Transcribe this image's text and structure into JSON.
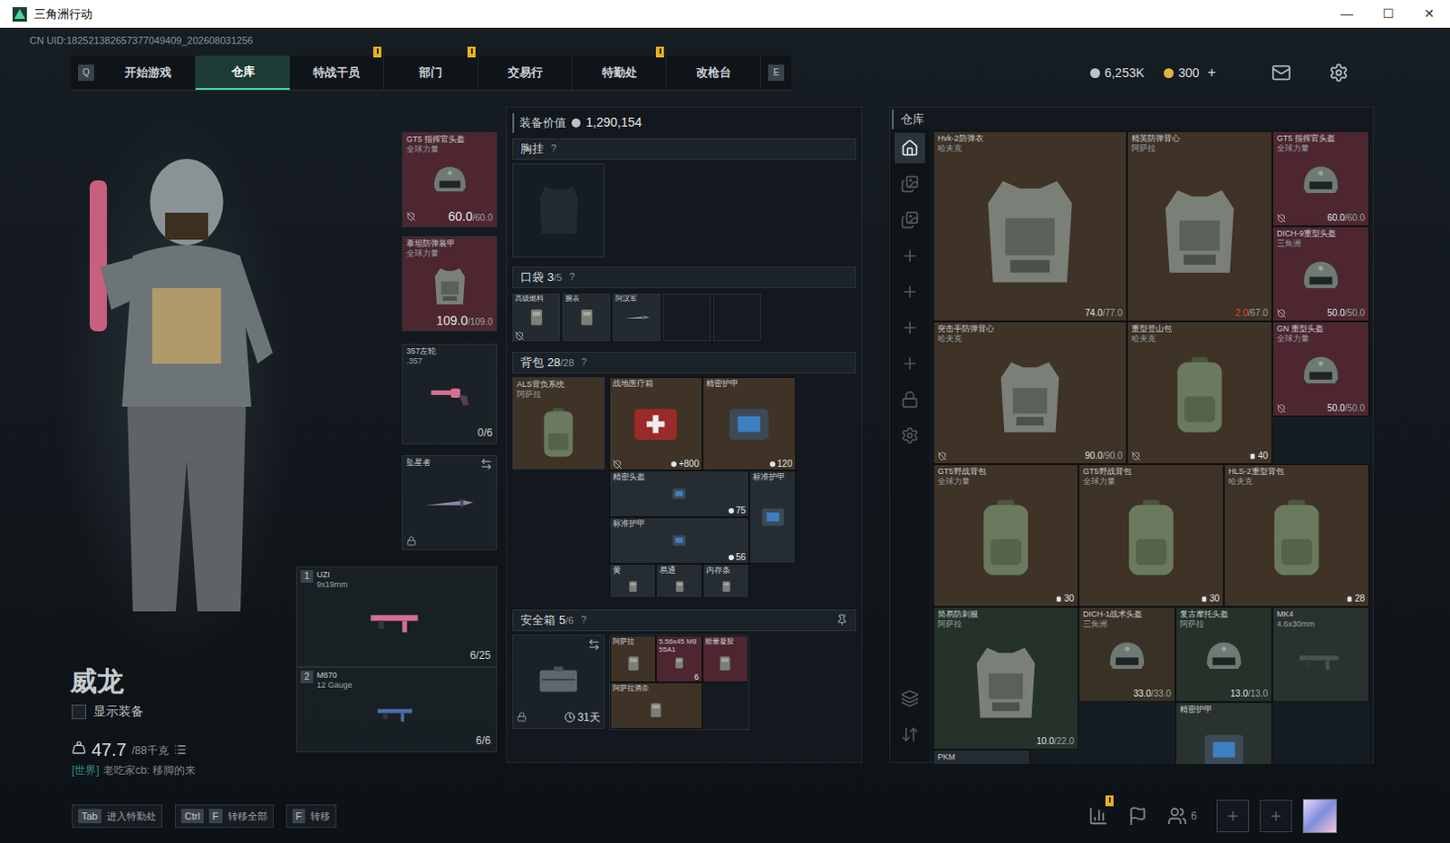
{
  "window": {
    "title": "三角洲行动",
    "controls": [
      "—",
      "☐",
      "✕"
    ]
  },
  "uid": "CN UID:182521382657377049409_202608031256",
  "nav": {
    "prev_key": "Q",
    "next_key": "E",
    "tabs": [
      {
        "label": "开始游戏",
        "selected": false,
        "alert": false
      },
      {
        "label": "仓库",
        "selected": true,
        "alert": false
      },
      {
        "label": "特战干员",
        "selected": false,
        "alert": true
      },
      {
        "label": "部门",
        "selected": false,
        "alert": true
      },
      {
        "label": "交易行",
        "selected": false,
        "alert": false
      },
      {
        "label": "特勤处",
        "selected": false,
        "alert": true
      },
      {
        "label": "改枪台",
        "selected": false,
        "alert": false
      }
    ]
  },
  "currency": [
    {
      "value": "6,253K",
      "add": "",
      "color": "#b8c2ca"
    },
    {
      "value": "300",
      "add": "+",
      "color": "#e3b341"
    }
  ],
  "operator": {
    "name": "威龙",
    "show_gear_label": "显示装备",
    "show_gear_checked": false,
    "weight": "47.7",
    "weight_max": "/88千克",
    "chat_channel": "[世界]",
    "chat_text": "老吃家cb: 移脚的来"
  },
  "equipment": [
    {
      "label": "GT5 指挥官头盔",
      "sub": "全球力量",
      "kind": "helmet",
      "value": "60.0",
      "max": "/60.0",
      "marked": true,
      "color": "#4d2630"
    },
    {
      "label": "泰坦防弹装甲",
      "sub": "全球力量",
      "kind": "armor",
      "value": "109.0",
      "max": "/109.0",
      "marked": false,
      "color": "#4d2630"
    },
    {
      "label": "357左轮",
      "sub": ".357",
      "kind": "pistol",
      "ammo": "0/6",
      "marked": false,
      "color": "#1b2227"
    },
    {
      "label": "坠星者",
      "sub": "",
      "kind": "knife",
      "locked": true,
      "marked": false,
      "color": "#1b2227"
    }
  ],
  "weapons": [
    {
      "slot": "1",
      "name": "UZI",
      "caliber": "9x19mm",
      "ammo": "6/25",
      "color": "#d46f91"
    },
    {
      "slot": "2",
      "name": "M870",
      "caliber": "12 Gauge",
      "ammo": "6/6",
      "color": "#4b6da8"
    }
  ],
  "loadout": {
    "value_label": "装备价值",
    "value": "1,290,154",
    "chest": {
      "label": "胸挂",
      "help": "?"
    },
    "pockets": {
      "label": "口袋",
      "count": "3",
      "max": "/5",
      "help": "?",
      "slots": [
        {
          "label": "高级燃料",
          "kind": "small",
          "empty": false,
          "marked": true
        },
        {
          "label": "腕表",
          "kind": "small",
          "empty": false,
          "marked": false
        },
        {
          "label": "阿汉军",
          "kind": "knife",
          "empty": false,
          "marked": false
        },
        {
          "label": "",
          "kind": "small",
          "empty": true,
          "marked": false
        },
        {
          "label": "",
          "kind": "small",
          "empty": true,
          "marked": false
        }
      ]
    },
    "backpack": {
      "label": "背包",
      "count": "28",
      "max": "/28",
      "help": "?",
      "bag": {
        "label": "ALS背负系统",
        "sub": "阿萨拉",
        "color": "#3f3226"
      },
      "items": [
        {
          "label": "战地医疗箱",
          "kind": "medkit",
          "stat": "+800",
          "marked": true,
          "color": "#3f3226"
        },
        {
          "label": "精密护甲",
          "kind": "plate",
          "stat": "120",
          "marked": false,
          "color": "#3f3226"
        },
        {
          "label": "精密头盔",
          "kind": "plate",
          "stat": "75",
          "marked": false,
          "color": "#252d33"
        },
        {
          "label": "标准护甲",
          "kind": "plate",
          "stat": "",
          "marked": false,
          "color": "#252d33"
        },
        {
          "label": "标准护甲",
          "kind": "plate",
          "stat": "56",
          "marked": false,
          "color": "#252d33"
        },
        {
          "label": "黄",
          "kind": "small",
          "stat": "",
          "marked": false,
          "color": "#252d33"
        },
        {
          "label": "易通",
          "kind": "small",
          "stat": "",
          "marked": false,
          "color": "#252d33"
        },
        {
          "label": "内存条",
          "kind": "small",
          "stat": "",
          "marked": false,
          "color": "#252d33"
        }
      ]
    },
    "safe": {
      "label": "安全箱",
      "count": "5",
      "max": "/6",
      "help": "?",
      "expiry": "31天",
      "locked": true,
      "items": [
        {
          "label": "阿萨拉",
          "kind": "small",
          "count": "",
          "color": "#3f3226"
        },
        {
          "label": "5.56x45 M855A1",
          "kind": "small",
          "count": "6",
          "color": "#4d2630"
        },
        {
          "label": "能量凝胶",
          "kind": "small",
          "count": "",
          "color": "#4d2630"
        },
        {
          "label": "阿萨拉酒壶",
          "kind": "small",
          "count": "",
          "color": "#3f3226"
        }
      ]
    }
  },
  "stash": {
    "title": "仓库",
    "sidebar": [
      {
        "kind": "home",
        "selected": true
      },
      {
        "kind": "page",
        "selected": false
      },
      {
        "kind": "page",
        "selected": false
      },
      {
        "kind": "add",
        "selected": false
      },
      {
        "kind": "add",
        "selected": false
      },
      {
        "kind": "add",
        "selected": false
      },
      {
        "kind": "add",
        "selected": false
      },
      {
        "kind": "lock",
        "selected": false
      },
      {
        "kind": "gear",
        "selected": false
      }
    ],
    "tools": [
      {
        "kind": "layers"
      },
      {
        "kind": "sort"
      }
    ],
    "items": [
      {
        "label": "Hvk-2防弹衣",
        "sub": "哈夫克",
        "kind": "armor",
        "value": "74.0",
        "max": "/77.0",
        "low": false,
        "capacity": "",
        "marked": false,
        "color": "#3f3226"
      },
      {
        "label": "精英防弹背心",
        "sub": "阿萨拉",
        "kind": "armor",
        "value": "2.0",
        "max": "/67.0",
        "low": true,
        "capacity": "",
        "marked": false,
        "color": "#3f3226"
      },
      {
        "label": "GT5 指挥官头盔",
        "sub": "全球力量",
        "kind": "helmet",
        "value": "60.0",
        "max": "/60.0",
        "low": false,
        "capacity": "",
        "marked": true,
        "color": "#4d2630"
      },
      {
        "label": "DICH-9重型头盔",
        "sub": "三角洲",
        "kind": "helmet",
        "value": "50.0",
        "max": "/50.0",
        "low": false,
        "capacity": "",
        "marked": true,
        "color": "#4d2630"
      },
      {
        "label": "突击手防弹背心",
        "sub": "哈夫克",
        "kind": "armor",
        "value": "90.0",
        "max": "/90.0",
        "low": false,
        "capacity": "",
        "marked": true,
        "color": "#3f3226"
      },
      {
        "label": "重型登山包",
        "sub": "哈夫克",
        "kind": "backpack",
        "value": "",
        "max": "",
        "low": false,
        "capacity": "40",
        "marked": true,
        "color": "#3f3226"
      },
      {
        "label": "GN 重型头盔",
        "sub": "全球力量",
        "kind": "helmet",
        "value": "50.0",
        "max": "/50.0",
        "low": false,
        "capacity": "",
        "marked": true,
        "color": "#4d2630"
      },
      {
        "label": "GT5野战背包",
        "sub": "全球力量",
        "kind": "backpack",
        "value": "",
        "max": "",
        "low": false,
        "capacity": "30",
        "marked": false,
        "color": "#3f3226"
      },
      {
        "label": "GT5野战背包",
        "sub": "全球力量",
        "kind": "backpack",
        "value": "",
        "max": "",
        "low": false,
        "capacity": "30",
        "marked": false,
        "color": "#3f3226"
      },
      {
        "label": "HLS-2重型背包",
        "sub": "哈夫克",
        "kind": "backpack",
        "value": "",
        "max": "",
        "low": false,
        "capacity": "28",
        "marked": false,
        "color": "#3f3226"
      },
      {
        "label": "简易防刺服",
        "sub": "阿萨拉",
        "kind": "armor",
        "value": "10.0",
        "max": "/22.0",
        "low": false,
        "capacity": "",
        "marked": false,
        "color": "#243229"
      },
      {
        "label": "DICH-1战术头盔",
        "sub": "三角洲",
        "kind": "helmet",
        "value": "33.0",
        "max": "/33.0",
        "low": false,
        "capacity": "",
        "marked": false,
        "color": "#3a3126"
      },
      {
        "label": "复古摩托头盔",
        "sub": "阿萨拉",
        "kind": "helmet",
        "value": "13.0",
        "max": "/13.0",
        "low": false,
        "capacity": "",
        "marked": false,
        "color": "#243229"
      },
      {
        "label": "MK4",
        "sub": "4.6x30mm",
        "kind": "weapon",
        "value": "",
        "max": "",
        "low": false,
        "capacity": "",
        "marked": false,
        "color": "#2a3230"
      },
      {
        "label": "精密护甲",
        "sub": "",
        "kind": "plate",
        "value": "",
        "max": "",
        "low": false,
        "capacity": "",
        "marked": false,
        "color": "#2a3230"
      },
      {
        "label": "PKM",
        "sub": "",
        "kind": "weapon",
        "value": "",
        "max": "",
        "low": false,
        "capacity": "",
        "marked": false,
        "color": "#252d33"
      }
    ]
  },
  "hints": [
    {
      "keys": [
        "Tab"
      ],
      "label": "进入特勤处"
    },
    {
      "keys": [
        "Ctrl",
        "F"
      ],
      "label": "转移全部"
    },
    {
      "keys": [
        "F"
      ],
      "label": "转移"
    }
  ],
  "social": {
    "stats_alert": true,
    "friends": "6",
    "party_slots": [
      {
        "empty": true
      },
      {
        "empty": true
      }
    ]
  }
}
